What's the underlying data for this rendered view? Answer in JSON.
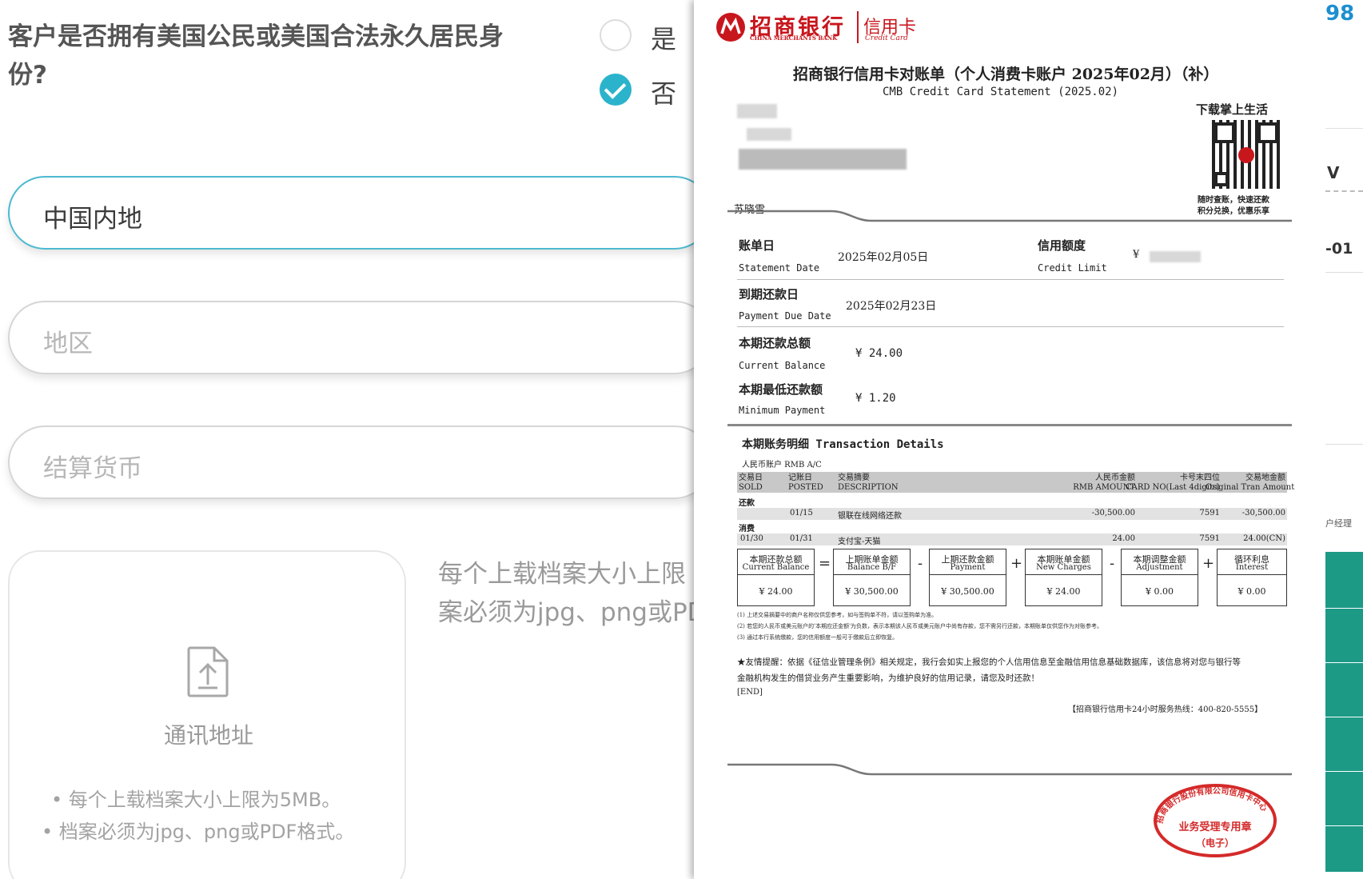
{
  "form": {
    "question": "客户是否拥有美国公民或美国合法永久居民身份?",
    "option_yes": "是",
    "option_no": "否",
    "selected": "否",
    "field_region_value": "中国内地",
    "field_area_placeholder": "地区",
    "field_currency_placeholder": "结算货币",
    "upload_label": "通讯地址",
    "note_line1": "• 每个上载档案大小上限为5MB。",
    "note_line2": "• 档案必须为jpg、png或PDF格式。",
    "side_line1": "每个上载档案大小上限",
    "side_line2": "案必须为jpg、png或PD"
  },
  "statement": {
    "brand_name": "招商银行",
    "brand_en": "CHINA MERCHANTS BANK",
    "brand_card": "信用卡",
    "brand_card_en": "Credit Card",
    "title_cn": "招商银行信用卡对账单（个人消费卡账户 2025年02月）（补）",
    "title_en": "CMB Credit Card Statement (2025.02)",
    "app_promo": "下载掌上生活",
    "app_promo_sub1": "随时查账，快速还款",
    "app_promo_sub2": "积分兑换，优惠乐享",
    "cardholder": "苏晓雪",
    "statement_date_label": "账单日",
    "statement_date_label_en": "Statement Date",
    "statement_date": "2025年02月05日",
    "credit_limit_label": "信用额度",
    "credit_limit_label_en": "Credit Limit",
    "credit_limit_currency": "¥",
    "due_date_label": "到期还款日",
    "due_date_label_en": "Payment Due Date",
    "due_date": "2025年02月23日",
    "current_balance_label": "本期还款总额",
    "current_balance_label_en": "Current Balance",
    "current_balance": "¥ 24.00",
    "min_payment_label": "本期最低还款额",
    "min_payment_label_en": "Minimum Payment",
    "min_payment": "¥ 1.20",
    "details_title": "本期账务明细 Transaction Details",
    "account_label": "人民币账户 RMB A/C",
    "columns": [
      {
        "cn": "交易日",
        "en": "SOLD"
      },
      {
        "cn": "记账日",
        "en": "POSTED"
      },
      {
        "cn": "交易摘要",
        "en": "DESCRIPTION"
      },
      {
        "cn": "人民币金额",
        "en": "RMB AMOUNT"
      },
      {
        "cn": "卡号末四位",
        "en": "CARD NO(Last 4digits)"
      },
      {
        "cn": "交易地金额",
        "en": "Original Tran Amount"
      }
    ],
    "section_repay": "还款",
    "repay_row": {
      "sold": "",
      "posted": "01/15",
      "desc": "银联在线网络还款",
      "amount": "-30,500.00",
      "card": "7591",
      "orig": "-30,500.00"
    },
    "section_spend": "消费",
    "spend_row": {
      "sold": "01/30",
      "posted": "01/31",
      "desc": "支付宝-天猫",
      "amount": "24.00",
      "card": "7591",
      "orig": "24.00(CN)"
    },
    "summary": [
      {
        "cn": "本期还款总额",
        "en": "Current Balance",
        "value": "¥ 24.00"
      },
      {
        "cn": "上期账单金额",
        "en": "Balance B/F",
        "value": "¥ 30,500.00"
      },
      {
        "cn": "上期还款金额",
        "en": "Payment",
        "value": "¥ 30,500.00"
      },
      {
        "cn": "本期账单金额",
        "en": "New Charges",
        "value": "¥ 24.00"
      },
      {
        "cn": "本期调整金额",
        "en": "Adjustment",
        "value": "¥ 0.00"
      },
      {
        "cn": "循环利息",
        "en": "Interest",
        "value": "¥ 0.00"
      }
    ],
    "operators": [
      "=",
      "-",
      "+",
      "-",
      "+"
    ],
    "footnote1": "(1) 上述交易摘要中的商户名称仅供您参考，如与签购单不符，请以签购单为准。",
    "footnote2": "(2) 若您的人民币或美元账户的'本期应还金额'为负数，表示本期该人民币或美元账户中尚有存款，您不需另行还款，本期账单仅供您作为对账参考。",
    "footnote3": "(3) 通过本行系统缴款，您的信用额度一般可于缴款后立即恢复。",
    "reminder1": "★友情提醒：依据《征信业管理条例》相关规定，我行会如实上报您的个人信用信息至金融信用信息基础数据库，该信息将对您与银行等",
    "reminder2": "金融机构发生的借贷业务产生重要影响，为维护良好的信用记录，请您及时还款！",
    "end_marker": "[END]",
    "hotline": "【招商银行信用卡24小时服务热线：400-820-5555】",
    "stamp_text_top": "招商银行股份有限公司信用卡中心",
    "stamp_text_mid": "业务受理专用章",
    "stamp_text_bottom": "（电子）"
  },
  "right_strip": {
    "frag1": "98",
    "frag2": "V",
    "frag3": "-01",
    "frag4": "户经理"
  },
  "colors": {
    "accent": "#2bb3cc",
    "brand_red": "#c8161d",
    "teal": "#1c9a86"
  }
}
